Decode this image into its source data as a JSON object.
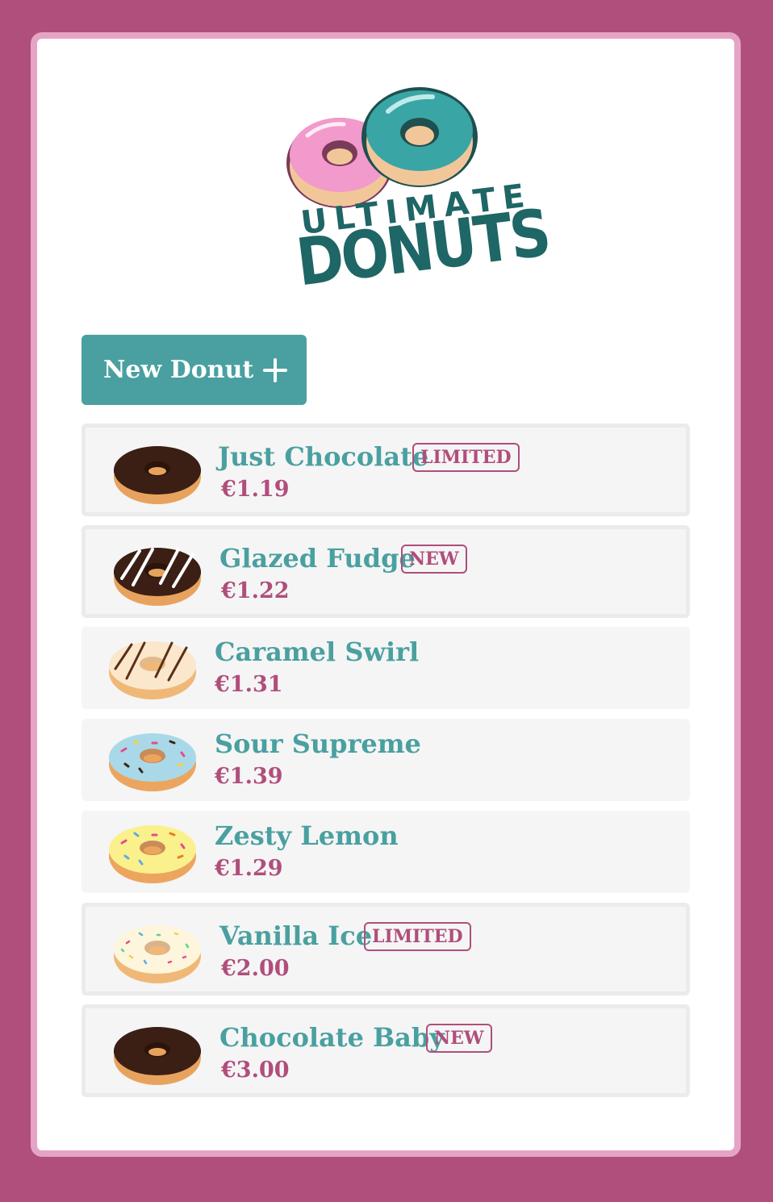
{
  "brand": {
    "line1": "ULTIMATE",
    "line2": "DONUTS"
  },
  "new_button": {
    "label": "New Donut"
  },
  "items": [
    {
      "name": "Just Chocolate",
      "price": "€1.19",
      "badge": "LIMITED",
      "style": "chocolate"
    },
    {
      "name": "Glazed Fudge",
      "price": "€1.22",
      "badge": "NEW",
      "style": "fudge"
    },
    {
      "name": "Caramel Swirl",
      "price": "€1.31",
      "badge": "",
      "style": "caramel"
    },
    {
      "name": "Sour Supreme",
      "price": "€1.39",
      "badge": "",
      "style": "blue-sprinkle"
    },
    {
      "name": "Zesty Lemon",
      "price": "€1.29",
      "badge": "",
      "style": "lemon-sprinkle"
    },
    {
      "name": "Vanilla Ice",
      "price": "€2.00",
      "badge": "LIMITED",
      "style": "vanilla-sprinkle"
    },
    {
      "name": "Chocolate Baby",
      "price": "€3.00",
      "badge": "NEW",
      "style": "chocolate"
    }
  ],
  "colors": {
    "page_bg": "#b04e7c",
    "card_border": "#e6a4c4",
    "accent_teal": "#4aa0a0",
    "accent_pink": "#b04e7c",
    "row_bg": "#f5f5f5"
  },
  "icons": [
    "donut-logo-icon",
    "plus-icon",
    "donut-icon"
  ]
}
